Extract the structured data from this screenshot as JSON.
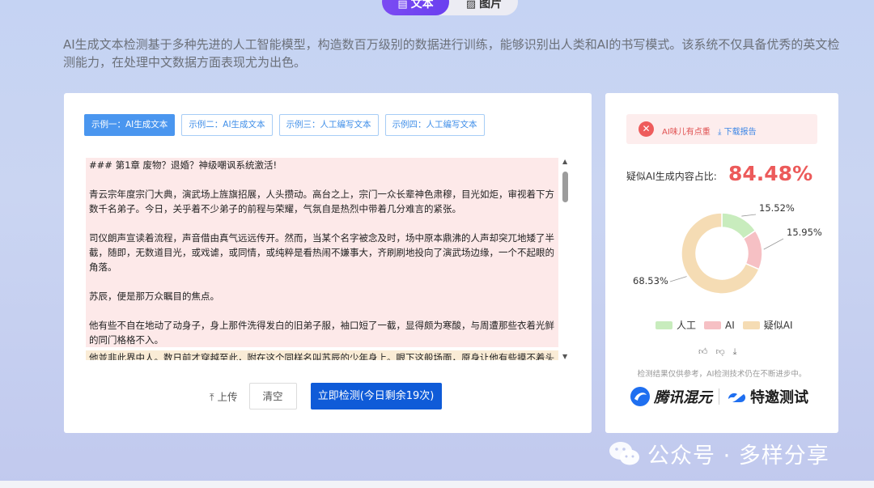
{
  "mode_toggle": {
    "text_label": "文本",
    "image_label": "图片",
    "text_icon": "document-icon",
    "image_icon": "image-icon"
  },
  "intro_text": "AI生成文本检测基于多种先进的人工智能模型，构造数百万级别的数据进行训练，能够识别出人类和AI的书写模式。该系统不仅具备优秀的英文检测能力，在处理中文数据方面表现尤为出色。",
  "examples": [
    {
      "label": "示例一：AI生成文本",
      "active": true
    },
    {
      "label": "示例二：AI生成文本",
      "active": false
    },
    {
      "label": "示例三：人工编写文本",
      "active": false
    },
    {
      "label": "示例四：人工编写文本",
      "active": false
    }
  ],
  "editor": {
    "paragraphs": [
      "### 第1章 废物？退婚？神级嘲讽系统激活!",
      "青云宗年度宗门大典，演武场上旌旗招展，人头攒动。高台之上，宗门一众长辈神色肃穆，目光如炬，审视着下方数千名弟子。今日，关乎着不少弟子的前程与荣耀，气氛自是热烈中带着几分难言的紧张。",
      "司仪朗声宣读着流程，声音借由真气远远传开。然而，当某个名字被念及时，场中原本鼎沸的人声却突兀地矮了半截，随即，无数道目光，或戏谑，或同情，或纯粹是看热闹不嫌事大，齐刷刷地投向了演武场边缘，一个不起眼的角落。",
      "苏辰，便是那万众瞩目的焦点。",
      "他有些不自在地动了动身子，身上那件洗得发白的旧弟子服，袖口短了一截，显得颇为寒酸，与周遭那些衣着光鲜的同门格格不入。",
      "他並非此界中人。数日前才穿越至此，附在这个同样名叫苏辰的少年身上。眼下这般场面，原身让他有些摸不着头脑。"
    ]
  },
  "actions": {
    "upload_label": "上传",
    "upload_icon": "upload-icon",
    "clear_label": "清空",
    "detect_label": "立即检测(今日剩余19次)"
  },
  "result": {
    "alert_text": "AI味儿有点重",
    "download_label": "下载报告",
    "download_icon": "download-icon",
    "ratio_label": "疑似AI生成内容占比:",
    "ratio_value": "84.48%",
    "disclaimer": "检测结果仅供参考，AI检测技术仍在不断进步中。",
    "feedback_icons": [
      "thumbs-up-icon",
      "thumbs-down-icon",
      "download-icon"
    ],
    "brand_hunyuan": "腾讯混元",
    "brand_invite": "特邀测试"
  },
  "colors": {
    "accent": "#0f5bd8",
    "toggle_active": "#6a3ff0",
    "ai_red": "#ec5a5a",
    "human_green": "#c8ecbd",
    "ai_pink": "#f6c0c4",
    "suspected_beige": "#f5dcb4"
  },
  "chart_data": {
    "type": "pie",
    "donut": true,
    "categories": [
      "人工",
      "AI",
      "疑似AI"
    ],
    "values": [
      15.52,
      15.95,
      68.53
    ],
    "value_labels": [
      "15.52%",
      "15.95%",
      "68.53%"
    ],
    "colors": [
      "#c8ecbd",
      "#f6c0c4",
      "#f5dcb4"
    ],
    "legend_position": "bottom"
  },
  "watermark": "公众号 · 多样分享"
}
